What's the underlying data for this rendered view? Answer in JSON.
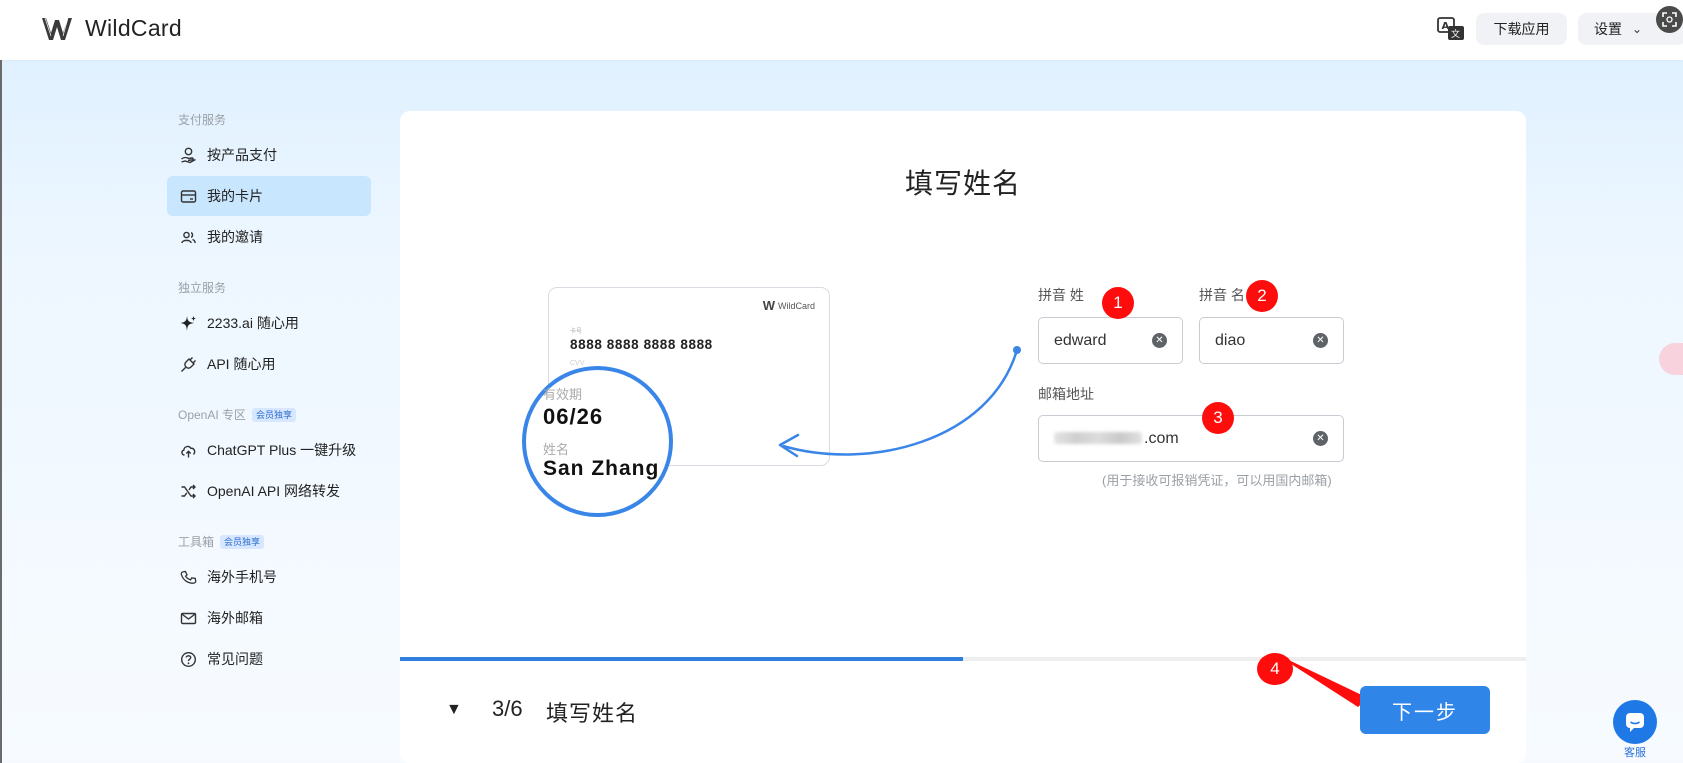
{
  "header": {
    "brand": "WildCard",
    "download_label": "下载应用",
    "settings_label": "设置"
  },
  "sidebar": {
    "sections": [
      {
        "title": "支付服务",
        "badge": ""
      },
      {
        "title": "独立服务",
        "badge": ""
      },
      {
        "title": "OpenAI 专区",
        "badge": "会员独享"
      },
      {
        "title": "工具箱",
        "badge": "会员独享"
      }
    ],
    "items": [
      {
        "label": "按产品支付",
        "icon": "coin-hand-icon",
        "active": false
      },
      {
        "label": "我的卡片",
        "icon": "card-icon",
        "active": true
      },
      {
        "label": "我的邀请",
        "icon": "users-icon",
        "active": false
      },
      {
        "label": "2233.ai 随心用",
        "icon": "sparkle-icon",
        "active": false
      },
      {
        "label": "API 随心用",
        "icon": "plug-icon",
        "active": false
      },
      {
        "label": "ChatGPT Plus 一键升级",
        "icon": "cloud-upload-icon",
        "active": false
      },
      {
        "label": "OpenAI API 网络转发",
        "icon": "shuffle-icon",
        "active": false
      },
      {
        "label": "海外手机号",
        "icon": "phone-icon",
        "active": false
      },
      {
        "label": "海外邮箱",
        "icon": "mail-icon",
        "active": false
      },
      {
        "label": "常见问题",
        "icon": "question-icon",
        "active": false
      }
    ]
  },
  "main": {
    "title": "填写姓名",
    "card": {
      "brand": "WildCard",
      "number_label": "卡号",
      "number": "8888 8888 8888 8888",
      "cvv_label": "CVV",
      "expiry_label": "有效期",
      "expiry": "06/26",
      "name_label": "姓名",
      "name": "San Zhang"
    },
    "form": {
      "surname_label": "拼音 姓",
      "surname_value": "edward",
      "given_label": "拼音 名",
      "given_value": "diao",
      "email_label": "邮箱地址",
      "email_suffix": ".com",
      "email_hint": "(用于接收可报销凭证，可以用国内邮箱)"
    },
    "markers": [
      "1",
      "2",
      "3",
      "4"
    ],
    "progress": {
      "step": 3,
      "total": 6,
      "fraction": 0.5
    },
    "step_label": "3/6",
    "step_title": "填写姓名",
    "next_label": "下一步"
  },
  "support_label": "客服",
  "colors": {
    "accent": "#2f86e8",
    "marker": "#ff0d0d",
    "active_nav": "#c9e6ff"
  }
}
